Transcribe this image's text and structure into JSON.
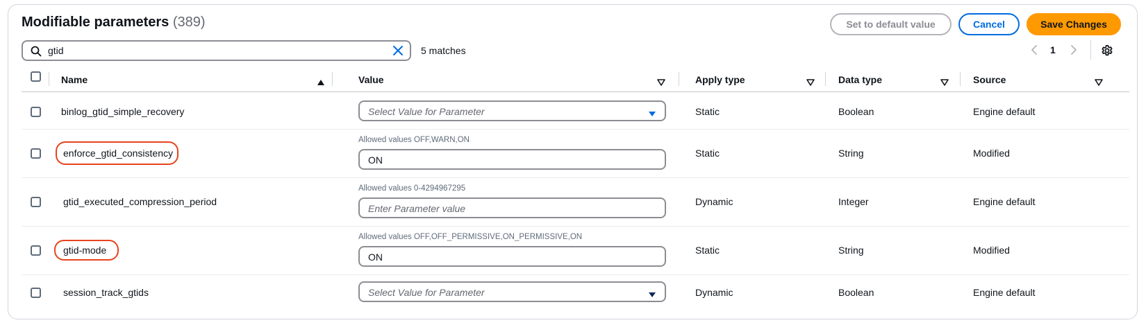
{
  "header": {
    "title": "Modifiable parameters",
    "count": "(389)",
    "set_default_label": "Set to default value",
    "cancel_label": "Cancel",
    "save_label": "Save Changes"
  },
  "search": {
    "value": "gtid",
    "matches": "5 matches"
  },
  "pagination": {
    "current_page": "1"
  },
  "columns": {
    "name": "Name",
    "value": "Value",
    "apply_type": "Apply type",
    "data_type": "Data type",
    "source": "Source"
  },
  "rows": [
    {
      "name": "binlog_gtid_simple_recovery",
      "value_kind": "select",
      "value_placeholder": "Select Value for Parameter",
      "allowed": "",
      "apply_type": "Static",
      "data_type": "Boolean",
      "source": "Engine default",
      "highlighted": false
    },
    {
      "name": "enforce_gtid_consistency",
      "value_kind": "input",
      "value": "ON",
      "allowed": "Allowed values OFF,WARN,ON",
      "apply_type": "Static",
      "data_type": "String",
      "source": "Modified",
      "highlighted": true
    },
    {
      "name": "gtid_executed_compression_period",
      "value_kind": "input",
      "value_placeholder": "Enter Parameter value",
      "allowed": "Allowed values 0-4294967295",
      "apply_type": "Dynamic",
      "data_type": "Integer",
      "source": "Engine default",
      "highlighted": false
    },
    {
      "name": "gtid-mode",
      "value_kind": "input",
      "value": "ON",
      "allowed": "Allowed values OFF,OFF_PERMISSIVE,ON_PERMISSIVE,ON",
      "apply_type": "Static",
      "data_type": "String",
      "source": "Modified",
      "highlighted": true
    },
    {
      "name": "session_track_gtids",
      "value_kind": "select",
      "value_placeholder": "Select Value for Parameter",
      "allowed": "",
      "apply_type": "Dynamic",
      "data_type": "Boolean",
      "source": "Engine default",
      "highlighted": false
    }
  ],
  "colors": {
    "primary": "#006ce0",
    "save": "#ff9900",
    "highlight": "#e8431e",
    "select_caret": "#006ce0",
    "text": "#0f141a"
  },
  "icons": {
    "search": "search-icon",
    "clear": "close-icon",
    "prev": "chevron-left-icon",
    "next": "chevron-right-icon",
    "settings": "gear-icon",
    "sort_asc": "sort-ascending-icon",
    "sort": "sort-icon",
    "dropdown": "caret-down-icon"
  }
}
